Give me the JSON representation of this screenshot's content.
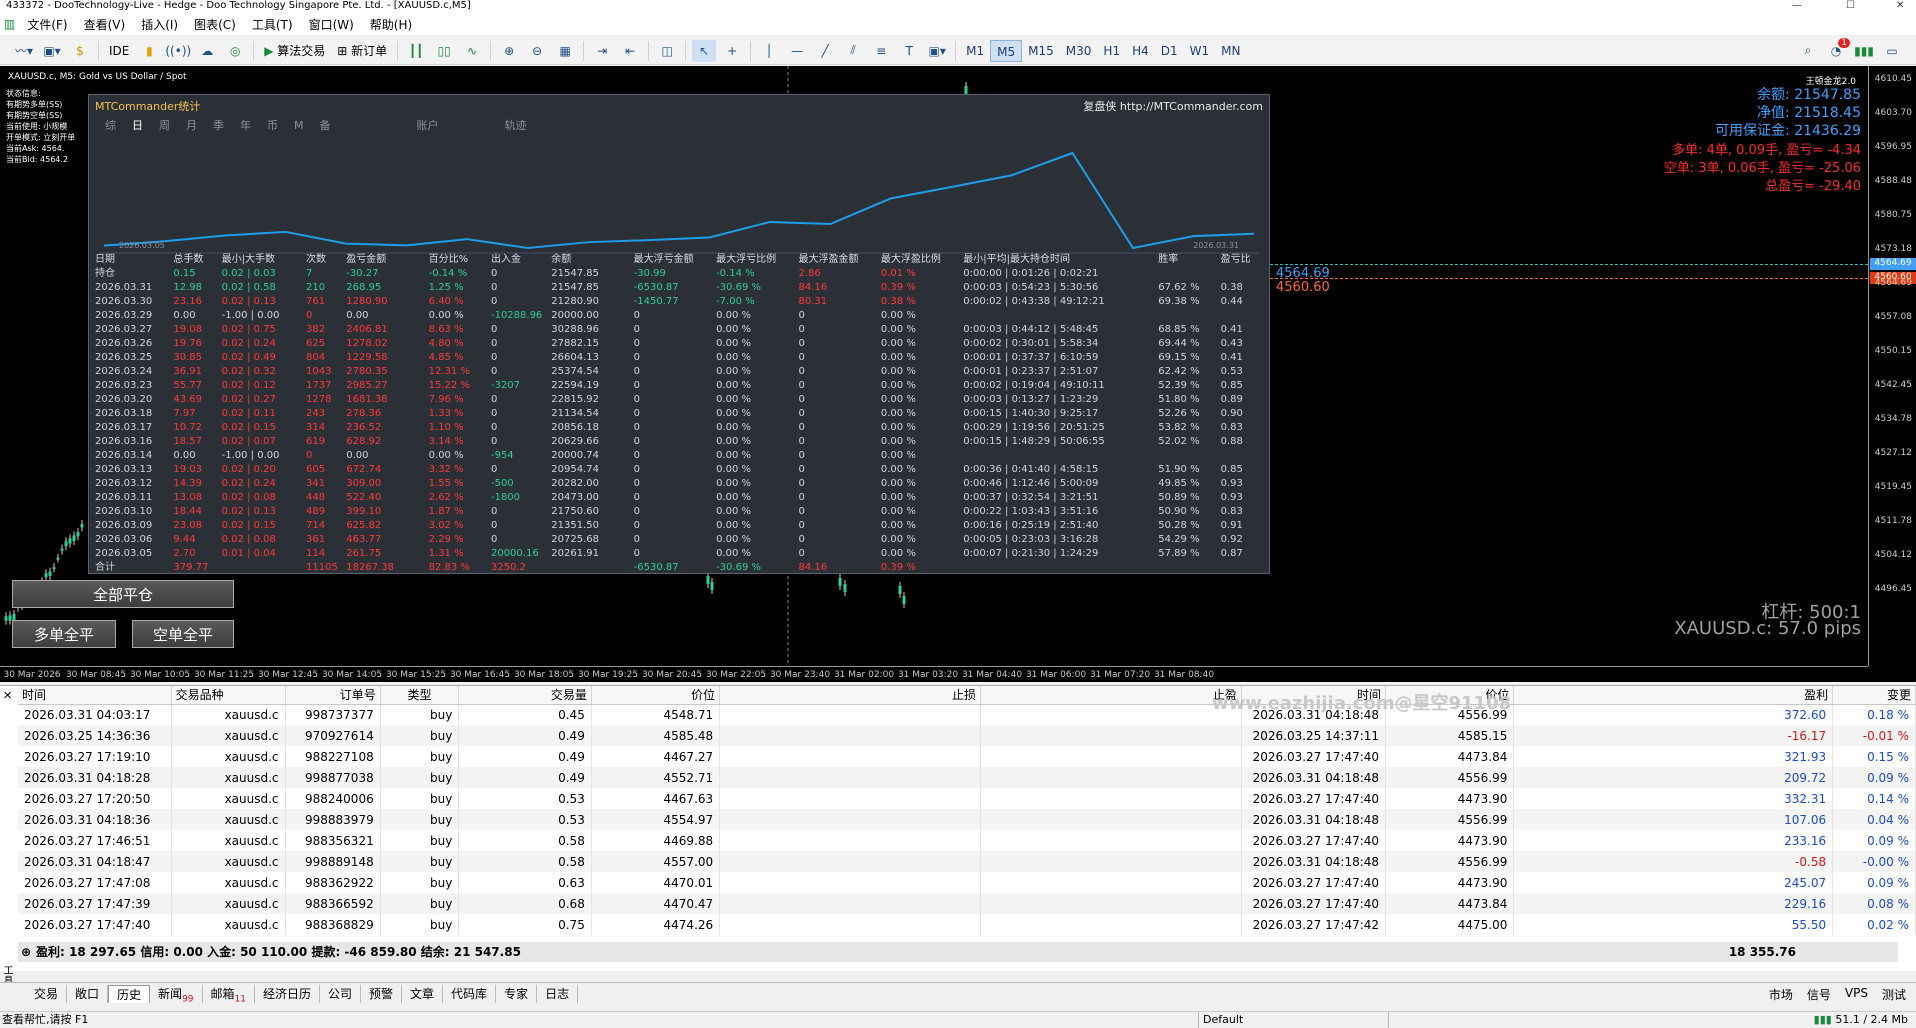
{
  "window": {
    "title": "433372 - DooTechnology-Live - Hedge - Doo Technology Singapore Pte. Ltd. - [XAUUSD.c,M5]"
  },
  "menu": [
    "文件(F)",
    "查看(V)",
    "插入(I)",
    "图表(C)",
    "工具(T)",
    "窗口(W)",
    "帮助(H)"
  ],
  "toolbar": {
    "ide": "IDE",
    "algo": "算法交易",
    "neworder": "新订单",
    "timeframes": [
      "M1",
      "M5",
      "M15",
      "M30",
      "H1",
      "H4",
      "D1",
      "W1",
      "MN"
    ],
    "active_tf": "M5",
    "notif": "1"
  },
  "chart": {
    "symbol": "XAUUSD.c, M5:  Gold vs US Dollar / Spot",
    "status_lines": [
      "状态信息:",
      "",
      "有期势多单(SS)",
      "有期势空单(SS)",
      "当前使用: 小规模",
      "开单模式: 立刻开单",
      "",
      "当前Ask: 4564.",
      "当前Bid: 4564.2"
    ],
    "top_right_label": "王顿金龙2.0",
    "balance": "余额: 21547.85",
    "equity": "净值: 21518.45",
    "margin": "可用保证金: 21436.29",
    "long": "多单: 4单, 0.09手, 盈亏= -4.34",
    "short": "空单: 3单, 0.06手, 盈亏= -25.06",
    "total": "总盈亏= -29.40",
    "leverage": "杠杆: 500:1",
    "spread": "XAUUSD.c: 57.0 pips",
    "line_ask": "4564.69",
    "line_bid": "4560.60",
    "tag_ask": "4564.69",
    "tag_bid": "4560.60",
    "prices": [
      "4610.45",
      "4603.70",
      "4596.95",
      "4588.48",
      "4580.75",
      "4573.18",
      "4564.69",
      "4557.08",
      "4550.15",
      "4542.45",
      "4534.78",
      "4527.12",
      "4519.45",
      "4511.78",
      "4504.12",
      "4496.45"
    ],
    "times": [
      "30 Mar 2026",
      "30 Mar 08:45",
      "30 Mar 10:05",
      "30 Mar 11:25",
      "30 Mar 12:45",
      "30 Mar 14:05",
      "30 Mar 15:25",
      "30 Mar 16:45",
      "30 Mar 18:05",
      "30 Mar 19:25",
      "30 Mar 20:45",
      "30 Mar 22:05",
      "30 Mar 23:40",
      "31 Mar 02:00",
      "31 Mar 03:20",
      "31 Mar 04:40",
      "31 Mar 06:00",
      "31 Mar 07:20",
      "31 Mar 08:40"
    ],
    "buttons": {
      "close_all": "全部平仓",
      "close_long": "多单全平",
      "close_short": "空单全平"
    }
  },
  "mt": {
    "title": "MTCommander统计",
    "link": "复盘侠 http://MTCommander.com",
    "tabs": [
      "综",
      "日",
      "周",
      "月",
      "季",
      "年",
      "币",
      "M",
      "备",
      "账户",
      "轨迹"
    ],
    "active_tab": "日",
    "curve_start": "2026.03.05",
    "curve_end": "2026.03.31",
    "headers": [
      "日期",
      "总手数",
      "最小|大手数",
      "次数",
      "盈亏金额",
      "百分比%",
      "出入金",
      "余额",
      "最大浮亏金额",
      "最大浮亏比例",
      "最大浮盈金额",
      "最大浮盈比例",
      "最小|平均|最大持仓时间",
      "胜率",
      "盈亏比"
    ],
    "rows": [
      [
        "持仓",
        "0.15",
        "0.02 | 0.03",
        "7",
        "-30.27",
        "-0.14 %",
        "0",
        "21547.85",
        "-30.99",
        "-0.14 %",
        "2.86",
        "0.01 %",
        "0:00:00 | 0:01:26 | 0:02:21",
        "",
        ""
      ],
      [
        "2026.03.31",
        "12.98",
        "0.02 | 0.58",
        "210",
        "268.95",
        "1.25 %",
        "0",
        "21547.85",
        "-6530.87",
        "-30.69 %",
        "84.16",
        "0.39 %",
        "0:00:03 | 0:54:23 | 5:30:56",
        "67.62 %",
        "0.38"
      ],
      [
        "2026.03.30",
        "23.16",
        "0.02 | 0.13",
        "761",
        "1280.90",
        "6.40 %",
        "0",
        "21280.90",
        "-1450.77",
        "-7.00 %",
        "80.31",
        "0.38 %",
        "0:00:02 | 0:43:38 | 49:12:21",
        "69.38 %",
        "0.44"
      ],
      [
        "2026.03.29",
        "0.00",
        "-1.00 | 0.00",
        "0",
        "0.00",
        "0.00 %",
        "-10288.96",
        "20000.00",
        "0",
        "0.00 %",
        "0",
        "0.00 %",
        "",
        "",
        ""
      ],
      [
        "2026.03.27",
        "19.08",
        "0.02 | 0.75",
        "382",
        "2406.81",
        "8.63 %",
        "0",
        "30288.96",
        "0",
        "0.00 %",
        "0",
        "0.00 %",
        "0:00:03 | 0:44:12 | 5:48:45",
        "68.85 %",
        "0.41"
      ],
      [
        "2026.03.26",
        "19.76",
        "0.02 | 0.24",
        "625",
        "1278.02",
        "4.80 %",
        "0",
        "27882.15",
        "0",
        "0.00 %",
        "0",
        "0.00 %",
        "0:00:02 | 0:30:01 | 5:58:34",
        "69.44 %",
        "0.43"
      ],
      [
        "2026.03.25",
        "30.85",
        "0.02 | 0.49",
        "804",
        "1229.58",
        "4.85 %",
        "0",
        "26604.13",
        "0",
        "0.00 %",
        "0",
        "0.00 %",
        "0:00:01 | 0:37:37 | 6:10:59",
        "69.15 %",
        "0.41"
      ],
      [
        "2026.03.24",
        "36.91",
        "0.02 | 0.32",
        "1043",
        "2780.35",
        "12.31 %",
        "0",
        "25374.54",
        "0",
        "0.00 %",
        "0",
        "0.00 %",
        "0:00:01 | 0:23:37 | 2:51:07",
        "62.42 %",
        "0.53"
      ],
      [
        "2026.03.23",
        "55.77",
        "0.02 | 0.12",
        "1737",
        "2985.27",
        "15.22 %",
        "-3207",
        "22594.19",
        "0",
        "0.00 %",
        "0",
        "0.00 %",
        "0:00:02 | 0:19:04 | 49:10:11",
        "52.39 %",
        "0.85"
      ],
      [
        "2026.03.20",
        "43.69",
        "0.02 | 0.27",
        "1278",
        "1681.38",
        "7.96 %",
        "0",
        "22815.92",
        "0",
        "0.00 %",
        "0",
        "0.00 %",
        "0:00:03 | 0:13:27 | 1:23:29",
        "51.80 %",
        "0.89"
      ],
      [
        "2026.03.18",
        "7.97",
        "0.02 | 0.11",
        "243",
        "278.36",
        "1.33 %",
        "0",
        "21134.54",
        "0",
        "0.00 %",
        "0",
        "0.00 %",
        "0:00:15 | 1:40:30 | 9:25:17",
        "52.26 %",
        "0.90"
      ],
      [
        "2026.03.17",
        "10.72",
        "0.02 | 0.15",
        "314",
        "236.52",
        "1.10 %",
        "0",
        "20856.18",
        "0",
        "0.00 %",
        "0",
        "0.00 %",
        "0:00:29 | 1:19:56 | 20:51:25",
        "53.82 %",
        "0.83"
      ],
      [
        "2026.03.16",
        "18.57",
        "0.02 | 0.07",
        "619",
        "628.92",
        "3.14 %",
        "0",
        "20629.66",
        "0",
        "0.00 %",
        "0",
        "0.00 %",
        "0:00:15 | 1:48:29 | 50:06:55",
        "52.02 %",
        "0.88"
      ],
      [
        "2026.03.14",
        "0.00",
        "-1.00 | 0.00",
        "0",
        "0.00",
        "0.00 %",
        "-954",
        "20000.74",
        "0",
        "0.00 %",
        "0",
        "0.00 %",
        "",
        "",
        ""
      ],
      [
        "2026.03.13",
        "19.03",
        "0.02 | 0.20",
        "605",
        "672.74",
        "3.32 %",
        "0",
        "20954.74",
        "0",
        "0.00 %",
        "0",
        "0.00 %",
        "0:00:36 | 0:41:40 | 4:58:15",
        "51.90 %",
        "0.85"
      ],
      [
        "2026.03.12",
        "14.39",
        "0.02 | 0.24",
        "341",
        "309.00",
        "1.55 %",
        "-500",
        "20282.00",
        "0",
        "0.00 %",
        "0",
        "0.00 %",
        "0:00:46 | 1:12:46 | 5:00:09",
        "49.85 %",
        "0.93"
      ],
      [
        "2026.03.11",
        "13.08",
        "0.02 | 0.08",
        "448",
        "522.40",
        "2.62 %",
        "-1800",
        "20473.00",
        "0",
        "0.00 %",
        "0",
        "0.00 %",
        "0:00:37 | 0:32:54 | 3:21:51",
        "50.89 %",
        "0.93"
      ],
      [
        "2026.03.10",
        "18.44",
        "0.02 | 0.13",
        "489",
        "399.10",
        "1.87 %",
        "0",
        "21750.60",
        "0",
        "0.00 %",
        "0",
        "0.00 %",
        "0:00:22 | 1:03:43 | 3:51:16",
        "50.90 %",
        "0.83"
      ],
      [
        "2026.03.09",
        "23.08",
        "0.02 | 0.15",
        "714",
        "625.82",
        "3.02 %",
        "0",
        "21351.50",
        "0",
        "0.00 %",
        "0",
        "0.00 %",
        "0:00:16 | 0:25:19 | 2:51:40",
        "50.28 %",
        "0.91"
      ],
      [
        "2026.03.06",
        "9.44",
        "0.02 | 0.08",
        "361",
        "463.77",
        "2.29 %",
        "0",
        "20725.68",
        "0",
        "0.00 %",
        "0",
        "0.00 %",
        "0:00:05 | 0:23:03 | 3:16:28",
        "54.29 %",
        "0.92"
      ],
      [
        "2026.03.05",
        "2.70",
        "0.01 | 0.04",
        "114",
        "261.75",
        "1.31 %",
        "20000.16",
        "20261.91",
        "0",
        "0.00 %",
        "0",
        "0.00 %",
        "0:00:07 | 0:21:30 | 1:24:29",
        "57.89 %",
        "0.87"
      ],
      [
        "合计",
        "379.77",
        "",
        "11105",
        "18267.38",
        "82.83 %",
        "3250.2",
        "",
        "-6530.87",
        "-30.69 %",
        "84.16",
        "0.39 %",
        "",
        "",
        ""
      ]
    ]
  },
  "history": {
    "headers": [
      "时间",
      "交易品种",
      "订单号",
      "类型",
      "交易量",
      "价位",
      "止损",
      "止盈",
      "时间",
      "价位",
      "盈利",
      "变更"
    ],
    "rows": [
      [
        "2026.03.31 04:03:17",
        "xauusd.c",
        "998737377",
        "buy",
        "0.45",
        "4548.71",
        "",
        "",
        "2026.03.31 04:18:48",
        "4556.99",
        "372.60",
        "0.18 %"
      ],
      [
        "2026.03.25 14:36:36",
        "xauusd.c",
        "970927614",
        "buy",
        "0.49",
        "4585.48",
        "",
        "",
        "2026.03.25 14:37:11",
        "4585.15",
        "-16.17",
        "-0.01 %"
      ],
      [
        "2026.03.27 17:19:10",
        "xauusd.c",
        "988227108",
        "buy",
        "0.49",
        "4467.27",
        "",
        "",
        "2026.03.27 17:47:40",
        "4473.84",
        "321.93",
        "0.15 %"
      ],
      [
        "2026.03.31 04:18:28",
        "xauusd.c",
        "998877038",
        "buy",
        "0.49",
        "4552.71",
        "",
        "",
        "2026.03.31 04:18:48",
        "4556.99",
        "209.72",
        "0.09 %"
      ],
      [
        "2026.03.27 17:20:50",
        "xauusd.c",
        "988240006",
        "buy",
        "0.53",
        "4467.63",
        "",
        "",
        "2026.03.27 17:47:40",
        "4473.90",
        "332.31",
        "0.14 %"
      ],
      [
        "2026.03.31 04:18:36",
        "xauusd.c",
        "998883979",
        "buy",
        "0.53",
        "4554.97",
        "",
        "",
        "2026.03.31 04:18:48",
        "4556.99",
        "107.06",
        "0.04 %"
      ],
      [
        "2026.03.27 17:46:51",
        "xauusd.c",
        "988356321",
        "buy",
        "0.58",
        "4469.88",
        "",
        "",
        "2026.03.27 17:47:40",
        "4473.90",
        "233.16",
        "0.09 %"
      ],
      [
        "2026.03.31 04:18:47",
        "xauusd.c",
        "998889148",
        "buy",
        "0.58",
        "4557.00",
        "",
        "",
        "2026.03.31 04:18:48",
        "4556.99",
        "-0.58",
        "-0.00 %"
      ],
      [
        "2026.03.27 17:47:08",
        "xauusd.c",
        "988362922",
        "buy",
        "0.63",
        "4470.01",
        "",
        "",
        "2026.03.27 17:47:40",
        "4473.90",
        "245.07",
        "0.09 %"
      ],
      [
        "2026.03.27 17:47:39",
        "xauusd.c",
        "988366592",
        "buy",
        "0.68",
        "4470.47",
        "",
        "",
        "2026.03.27 17:47:40",
        "4473.84",
        "229.16",
        "0.08 %"
      ],
      [
        "2026.03.27 17:47:40",
        "xauusd.c",
        "988368829",
        "buy",
        "0.75",
        "4474.26",
        "",
        "",
        "2026.03.27 17:47:42",
        "4475.00",
        "55.50",
        "0.02 %"
      ]
    ],
    "summary": "盈利: 18 297.65  信用: 0.00  入金: 50 110.00  提款: -46 859.80  结余: 21 547.85",
    "total": "18 355.76",
    "watermark": "www.eazhijia.com@星空91108"
  },
  "tabs": [
    {
      "label": "交易"
    },
    {
      "label": "敞口"
    },
    {
      "label": "历史"
    },
    {
      "label": "新闻",
      "badge": "99"
    },
    {
      "label": "邮箱",
      "badge": "11"
    },
    {
      "label": "经济日历"
    },
    {
      "label": "公司"
    },
    {
      "label": "预警"
    },
    {
      "label": "文章"
    },
    {
      "label": "代码库"
    },
    {
      "label": "专家"
    },
    {
      "label": "日志"
    }
  ],
  "active_tab": "历史",
  "right_tabs": [
    "市场",
    "信号",
    "VPS",
    "测试"
  ],
  "toolbox_label": "工具箱",
  "status": {
    "help": "查看帮忙,请按 F1",
    "profile": "Default",
    "net": "51.1 / 2.4 Mb"
  },
  "colors": {
    "pos": "#2ecf96",
    "neg": "#ff3a3a",
    "blue": "#3fa0ff"
  }
}
